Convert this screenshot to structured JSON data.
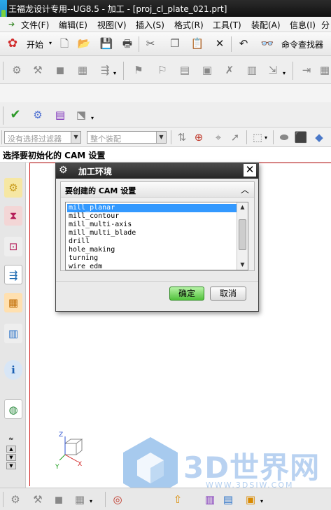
{
  "window": {
    "title": "王福龙设计专用--UG8.5 - 加工 - [proj_cl_plate_021.prt]"
  },
  "menu": {
    "items": [
      "文件(F)",
      "编辑(E)",
      "视图(V)",
      "插入(S)",
      "格式(R)",
      "工具(T)",
      "装配(A)",
      "信息(I)",
      "分"
    ]
  },
  "toolbar": {
    "start_label": "开始",
    "command_finder_label": "命令查找器"
  },
  "selection_bar": {
    "filter_placeholder": "没有选择过滤器",
    "scope_placeholder": "整个装配"
  },
  "cue_line": "选择要初始化的 CAM 设置",
  "dialog": {
    "title": "加工环境",
    "group_label": "要创建的 CAM 设置",
    "list_items": [
      "mill_planar",
      "mill_contour",
      "mill_multi-axis",
      "mill_multi_blade",
      "drill",
      "hole_making",
      "turning",
      "wire_edm"
    ],
    "selected_index": 0,
    "ok_label": "确定",
    "cancel_label": "取消"
  },
  "watermark": {
    "brand": "3D世界网",
    "url": "WWW.3DSJW.COM"
  },
  "triad": {
    "z": "Z",
    "y": "Y",
    "x": "X"
  },
  "colors": {
    "title_bg": "#1c1c1c",
    "dialog_header": "#333333",
    "list_selection": "#3399ff",
    "ok_button": "#6fd257",
    "graphics_border": "#d02020"
  }
}
